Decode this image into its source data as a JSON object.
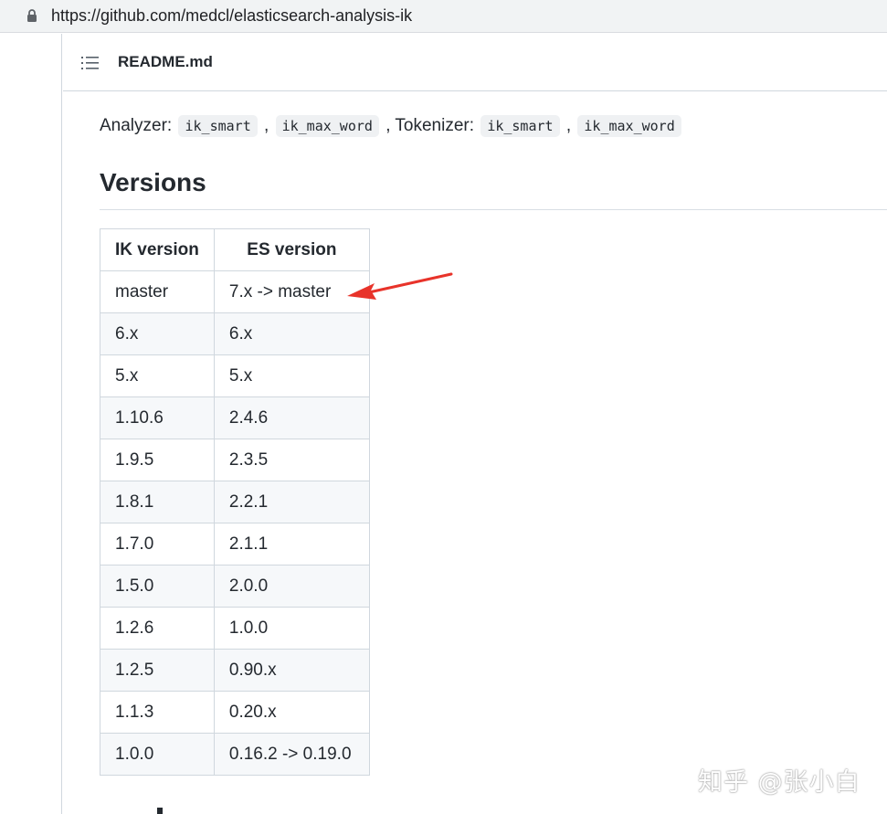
{
  "browser": {
    "url": "https://github.com/medcl/elasticsearch-analysis-ik",
    "lock_icon": "lock-icon"
  },
  "readme": {
    "list_icon": "list-icon",
    "title": "README.md"
  },
  "analyzer": {
    "analyzer_label": "Analyzer:",
    "analyzer_1": "ik_smart",
    "sep_1": ",",
    "analyzer_2": "ik_max_word",
    "sep_2": ",",
    "tokenizer_label": "Tokenizer:",
    "tokenizer_1": "ik_smart",
    "sep_3": ",",
    "tokenizer_2": "ik_max_word"
  },
  "versions": {
    "title": "Versions",
    "headers": [
      "IK version",
      "ES version"
    ],
    "rows": [
      [
        "master",
        "7.x -> master"
      ],
      [
        "6.x",
        "6.x"
      ],
      [
        "5.x",
        "5.x"
      ],
      [
        "1.10.6",
        "2.4.6"
      ],
      [
        "1.9.5",
        "2.3.5"
      ],
      [
        "1.8.1",
        "2.2.1"
      ],
      [
        "1.7.0",
        "2.1.1"
      ],
      [
        "1.5.0",
        "2.0.0"
      ],
      [
        "1.2.6",
        "1.0.0"
      ],
      [
        "1.2.5",
        "0.90.x"
      ],
      [
        "1.1.3",
        "0.20.x"
      ],
      [
        "1.0.0",
        "0.16.2 -> 0.19.0"
      ]
    ]
  },
  "annotation": {
    "arrow_color": "#e8332a"
  },
  "watermark": {
    "text": "知乎 @张小白"
  }
}
